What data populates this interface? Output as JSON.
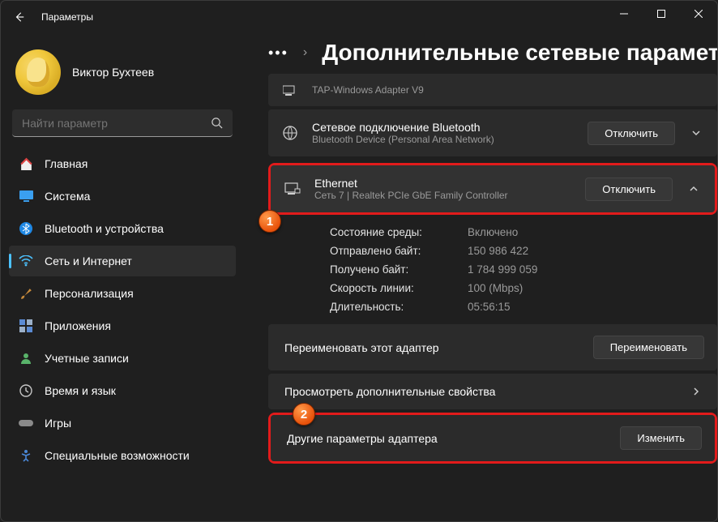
{
  "window": {
    "title": "Параметры"
  },
  "profile": {
    "name": "Виктор Бухтеев",
    "sub": ""
  },
  "search": {
    "placeholder": "Найти параметр"
  },
  "nav": [
    {
      "label": "Главная"
    },
    {
      "label": "Система"
    },
    {
      "label": "Bluetooth и устройства"
    },
    {
      "label": "Сеть и Интернет"
    },
    {
      "label": "Персонализация"
    },
    {
      "label": "Приложения"
    },
    {
      "label": "Учетные записи"
    },
    {
      "label": "Время и язык"
    },
    {
      "label": "Игры"
    },
    {
      "label": "Специальные возможности"
    }
  ],
  "page": {
    "title": "Дополнительные сетевые параметры"
  },
  "adapters": {
    "tap": {
      "title": "TAP-Windows Adapter V9"
    },
    "bt": {
      "title": "Сетевое подключение Bluetooth",
      "sub": "Bluetooth Device (Personal Area Network)",
      "button": "Отключить"
    },
    "eth": {
      "title": "Ethernet",
      "sub": "Сеть 7 | Realtek PCIe GbE Family Controller",
      "button": "Отключить"
    }
  },
  "stats": {
    "state_k": "Состояние среды:",
    "state_v": "Включено",
    "sent_k": "Отправлено байт:",
    "sent_v": "150 986 422",
    "recv_k": "Получено байт:",
    "recv_v": "1 784 999 059",
    "speed_k": "Скорость линии:",
    "speed_v": "100 (Mbps)",
    "dur_k": "Длительность:",
    "dur_v": "05:56:15"
  },
  "actions": {
    "rename_label": "Переименовать этот адаптер",
    "rename_btn": "Переименовать",
    "view_more": "Просмотреть дополнительные свойства",
    "other_label": "Другие параметры адаптера",
    "other_btn": "Изменить"
  },
  "markers": {
    "one": "1",
    "two": "2"
  }
}
